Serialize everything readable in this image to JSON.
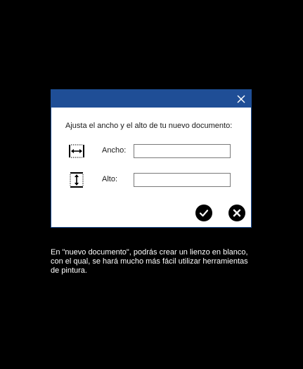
{
  "dialog": {
    "prompt": "Ajusta el ancho y el alto de tu nuevo documento:",
    "width_label": "Ancho:",
    "width_value": "",
    "height_label": "Alto:",
    "height_value": "",
    "titlebar_color": "#1f4e96",
    "close_icon": "close-icon",
    "confirm_icon": "checkmark-circle-icon",
    "cancel_icon": "x-circle-icon"
  },
  "caption": "En \"nuevo documento\", podrás crear un lienzo en blanco, con el qual, se hará mucho más fácil utilizar herramientas de pintura."
}
